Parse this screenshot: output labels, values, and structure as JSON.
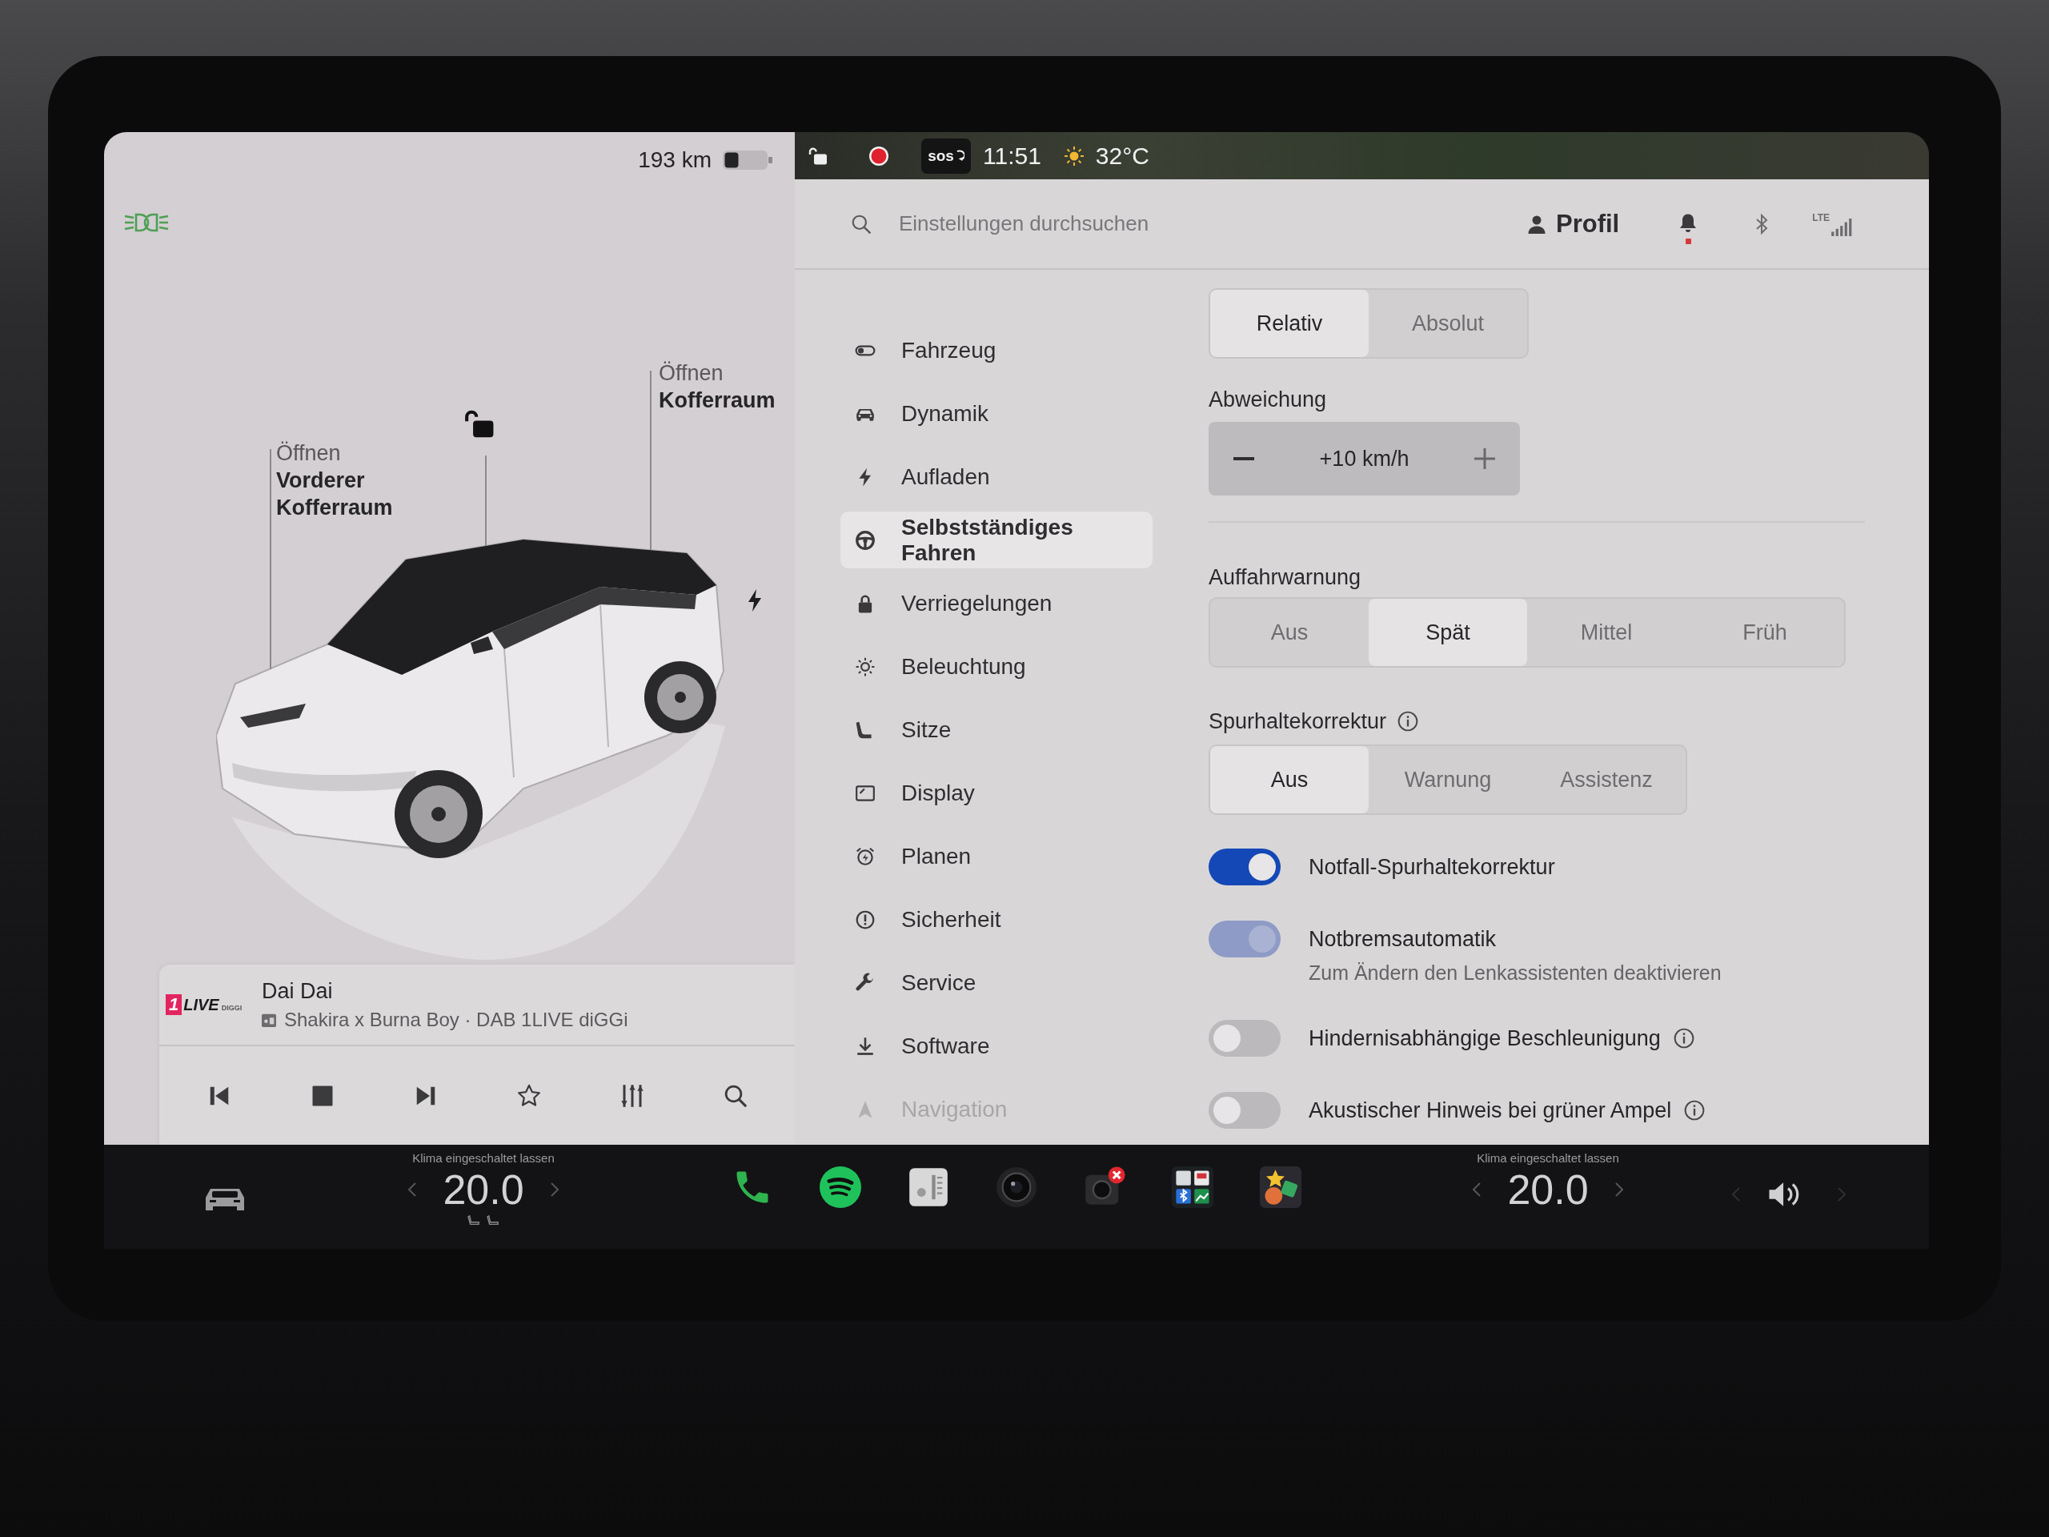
{
  "status_bar": {
    "range": "193 km",
    "sos": "sos",
    "time": "11:51",
    "temperature": "32°C"
  },
  "vehicle": {
    "trunk_buttons": [
      {
        "action": "Öffnen",
        "target": "Vorderer Kofferraum"
      },
      {
        "action": "Öffnen",
        "target": "Kofferraum"
      }
    ]
  },
  "media": {
    "logo": {
      "badge": "1",
      "name": "LIVE",
      "tag": "DIGGI"
    },
    "title": "Dai Dai",
    "subtitle": "Shakira x Burna Boy · DAB 1LIVE diGGi"
  },
  "settings": {
    "search": {
      "placeholder": "Einstellungen durchsuchen"
    },
    "profile": "Profil",
    "notifications": {
      "unread": true
    },
    "network": "LTE",
    "sidebar": {
      "items": [
        {
          "label": "Fahrzeug",
          "selected": false,
          "faded": false
        },
        {
          "label": "Dynamik",
          "selected": false,
          "faded": false
        },
        {
          "label": "Aufladen",
          "selected": false,
          "faded": false
        },
        {
          "label": "Selbstständiges Fahren",
          "selected": true,
          "faded": false
        },
        {
          "label": "Verriegelungen",
          "selected": false,
          "faded": false
        },
        {
          "label": "Beleuchtung",
          "selected": false,
          "faded": false
        },
        {
          "label": "Sitze",
          "selected": false,
          "faded": false
        },
        {
          "label": "Display",
          "selected": false,
          "faded": false
        },
        {
          "label": "Planen",
          "selected": false,
          "faded": false
        },
        {
          "label": "Sicherheit",
          "selected": false,
          "faded": false
        },
        {
          "label": "Service",
          "selected": false,
          "faded": false
        },
        {
          "label": "Software",
          "selected": false,
          "faded": false
        },
        {
          "label": "Navigation",
          "selected": false,
          "faded": true
        }
      ]
    },
    "speed_mode": {
      "options": [
        {
          "label": "Relativ",
          "selected": true
        },
        {
          "label": "Absolut",
          "selected": false
        }
      ]
    },
    "offset": {
      "label": "Abweichung",
      "value": "+10 km/h"
    },
    "collision_warning": {
      "label": "Auffahrwarnung",
      "options": [
        {
          "label": "Aus",
          "selected": false
        },
        {
          "label": "Spät",
          "selected": true
        },
        {
          "label": "Mittel",
          "selected": false
        },
        {
          "label": "Früh",
          "selected": false
        }
      ]
    },
    "lane_departure": {
      "label": "Spurhaltekorrektur",
      "info": true,
      "options": [
        {
          "label": "Aus",
          "selected": true
        },
        {
          "label": "Warnung",
          "selected": false
        },
        {
          "label": "Assistenz",
          "selected": false
        }
      ]
    },
    "toggles": [
      {
        "label": "Notfall-Spurhaltekorrektur",
        "on": true,
        "disabled": false,
        "info": false
      },
      {
        "label": "Notbremsautomatik",
        "on": true,
        "disabled": true,
        "info": false,
        "note": "Zum Ändern den Lenkassistenten deaktivieren"
      },
      {
        "label": "Hindernisabhängige Beschleunigung",
        "on": false,
        "disabled": false,
        "info": true
      },
      {
        "label": "Akustischer Hinweis bei grüner Ampel",
        "on": false,
        "disabled": false,
        "info": true
      }
    ]
  },
  "dock": {
    "climate": [
      {
        "label": "Klima eingeschaltet lassen",
        "temperature": "20.0"
      },
      {
        "label": "Klima eingeschaltet lassen",
        "temperature": "20.0"
      }
    ]
  }
}
